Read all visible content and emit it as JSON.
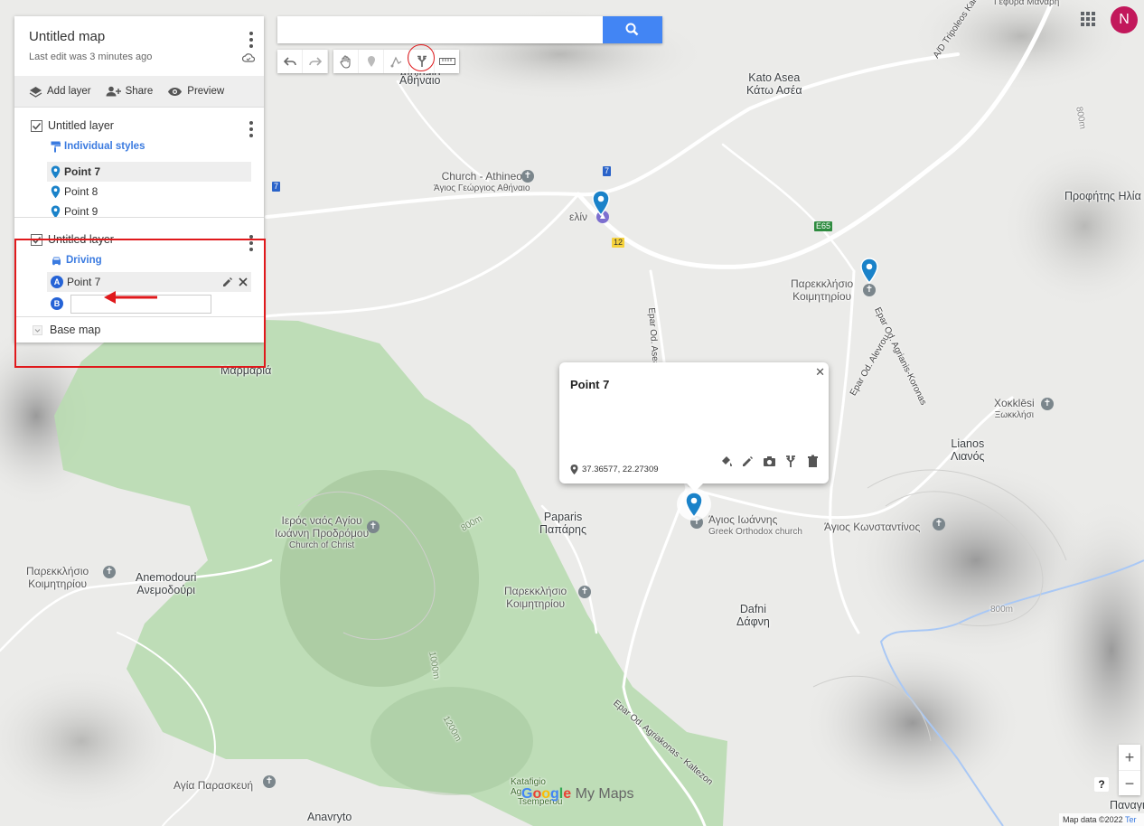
{
  "panel": {
    "map_title": "Untitled map",
    "last_edit": "Last edit was 3 minutes ago",
    "actions": {
      "add_layer": "Add layer",
      "share": "Share",
      "preview": "Preview"
    },
    "layer1": {
      "name": "Untitled layer",
      "style": "Individual styles",
      "items": [
        "Point 7",
        "Point 8",
        "Point 9"
      ]
    },
    "layer2": {
      "name": "Untitled layer",
      "mode": "Driving",
      "stop_a": {
        "badge": "A",
        "label": "Point 7"
      },
      "stop_b": {
        "badge": "B",
        "value": ""
      }
    },
    "base_map": "Base map"
  },
  "popup": {
    "title": "Point 7",
    "coords": "37.36577, 22.27309"
  },
  "map_labels": {
    "kato_asea": "Kato Asea",
    "kato_asea_gr": "Κάτω Ασέα",
    "athinaio_gr": "Αθήναιο",
    "athinaio_top": "Athinaio",
    "church_athineo": "Church - Athineo",
    "church_athineo_gr": "Άγιος Γεώργιος Αθήναιο",
    "elin": "ελίν",
    "profitis": "Προφήτης Ηλία",
    "parekklisio1_a": "Παρεκκλήσιο",
    "parekklisio1_b": "Κοιμητηρίου",
    "xokklesi": "Χοκklēsi",
    "xokklesi_gr": "Ξωκκλήσι",
    "lianos": "Lianos",
    "lianos_gr": "Λιανός",
    "marmaria_gr": "Μαρμαριά",
    "paparis": "Paparis",
    "paparis_gr": "Παπάρης",
    "agios_ioannis": "Άγιος Ιωάννης",
    "greek_church": "Greek Orthodox church",
    "agios_konstantinos": "Άγιος Κωνσταντίνος",
    "dafni": "Dafni",
    "dafni_gr": "Δάφνη",
    "ieros_a": "Ιερός ναός Αγίου",
    "ieros_b": "Ιωάννη Προδρόμου",
    "church_of_christ": "Church of Christ",
    "anemodouri": "Anemodouri",
    "anemodouri_gr": "Ανεμοδούρι",
    "parekklisio2_a": "Παρεκκλήσιο",
    "parekklisio2_b": "Κοιμητηρίου",
    "parekklisio3_a": "Παρεκκλήσιο",
    "parekklisio3_b": "Κοιμητηρίου",
    "agia_paraskevi": "Αγία Παρασκευή",
    "anavryto": "Anavryto",
    "katafigio": "Katafigio",
    "ag": "Ag",
    "tsemperou": "Tsemperou",
    "gefyra": "Γέφυρα Μαναρή",
    "panagia": "Παναγι",
    "road_e65": "E65",
    "road_7a": "7",
    "road_7b": "7",
    "road_12": "12",
    "road_tripoleos": "A/D Tripoleos Kalamatas",
    "road_epar_aseas": "Epar Od. Aseas",
    "road_epar_agrianis": "Epar Od. Agrianis-Koronas",
    "road_epar_alevrou": "Epar Od. Alevrou",
    "road_epar_agriakonas": "Epar Od. Agriakonas - Kaltezon",
    "elev_800a": "800m",
    "elev_800b": "800m",
    "elev_800c": "800m",
    "elev_1000": "1000m",
    "elev_1200": "1200m"
  },
  "footer": {
    "map_data": "Map data ©2022",
    "terms": "Ter"
  },
  "logo": {
    "my_maps": "My Maps"
  },
  "avatar": {
    "initial": "N"
  },
  "zoom": {
    "in": "+",
    "out": "−"
  },
  "help": "?",
  "colors": {
    "accent": "#4285f4",
    "badge": "#2563d6",
    "highlight": "#e0191c",
    "forest": "#b8dcb0"
  }
}
